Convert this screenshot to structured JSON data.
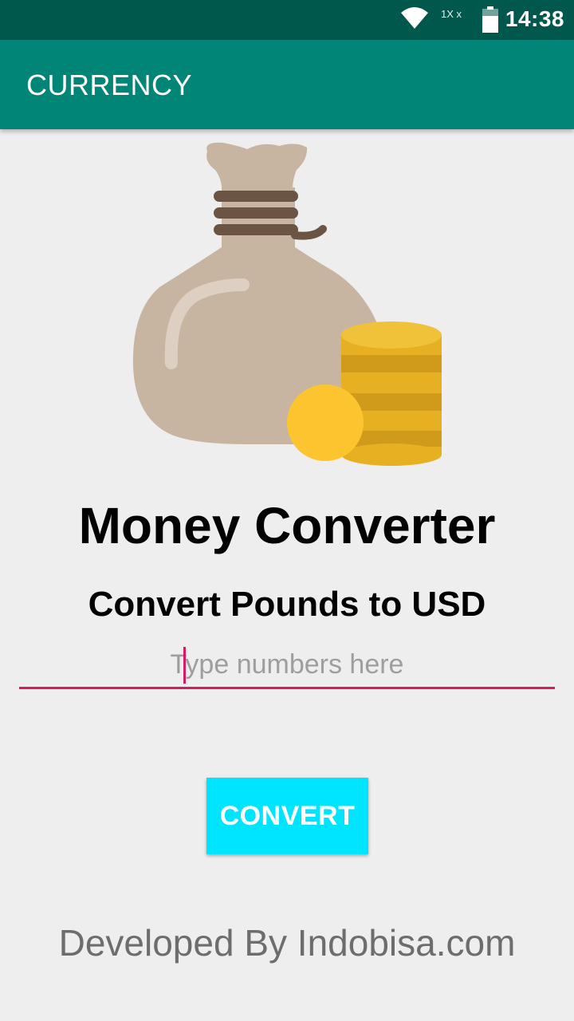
{
  "status_bar": {
    "time": "14:38",
    "sim_label": "1X x",
    "icons": [
      "wifi-icon",
      "signal-icon",
      "battery-icon"
    ]
  },
  "app_bar": {
    "title": "CURRENCY",
    "color": "#008577"
  },
  "hero": {
    "image": "money-bag-with-coins-illustration"
  },
  "main": {
    "title": "Money Converter",
    "subtitle": "Convert Pounds to USD",
    "amount_input": {
      "value": "",
      "placeholder": "Type numbers here"
    },
    "convert_button_label": "CONVERT",
    "accent_color": "#d81b60",
    "button_color": "#00e5ff"
  },
  "footer": {
    "text": "Developed By Indobisa.com"
  }
}
